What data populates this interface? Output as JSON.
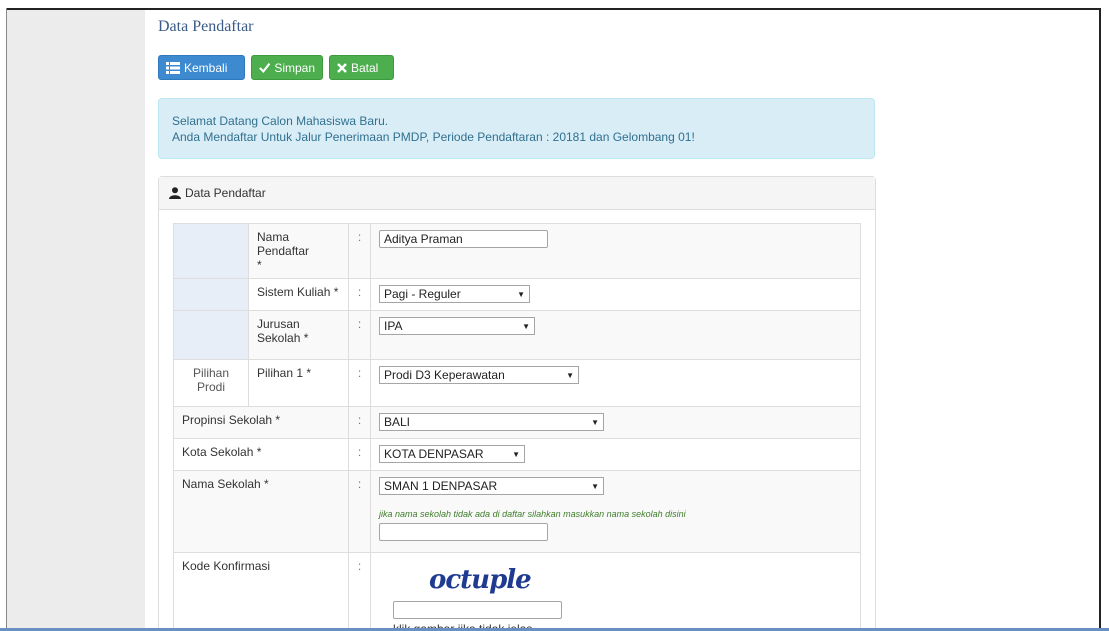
{
  "page": {
    "title": "Data Pendaftar"
  },
  "toolbar": {
    "back_label": "Kembali",
    "save_label": "Simpan",
    "cancel_label": "Batal"
  },
  "alert": {
    "line1": "Selamat Datang Calon Mahasiswa Baru.",
    "line2": "Anda Mendaftar Untuk Jalur Penerimaan PMDP, Periode Pendaftaran : 20181 dan Gelombang 01!"
  },
  "panel": {
    "title": "Data Pendaftar"
  },
  "form": {
    "sep": ":",
    "nama_label": "Nama Pendaftar",
    "nama_star": "*",
    "nama_value": "Aditya Praman",
    "sistem_label": "Sistem Kuliah *",
    "sistem_value": "Pagi - Reguler",
    "jurusan_label": "Jurusan Sekolah *",
    "jurusan_value": "IPA",
    "pilihan_prodi_label": "Pilihan Prodi",
    "pilihan1_label": "Pilihan 1 *",
    "pilihan1_value": "Prodi D3 Keperawatan",
    "propinsi_label": "Propinsi Sekolah *",
    "propinsi_value": "BALI",
    "kota_label": "Kota Sekolah *",
    "kota_value": "KOTA DENPASAR",
    "sekolah_label": "Nama Sekolah *",
    "sekolah_value": "SMAN 1 DENPASAR",
    "sekolah_hint": "jika nama sekolah tidak ada di daftar silahkan masukkan nama sekolah disini",
    "sekolah_other_value": "",
    "kode_label": "Kode Konfirmasi",
    "captcha_text": "octuple",
    "captcha_input_value": "",
    "captcha_hint": "klik gambar jika tidak jelas"
  },
  "colors": {
    "primary": "#3d8ad0",
    "success": "#4cae4c",
    "info_bg": "#d9edf7",
    "info_text": "#31708f"
  }
}
